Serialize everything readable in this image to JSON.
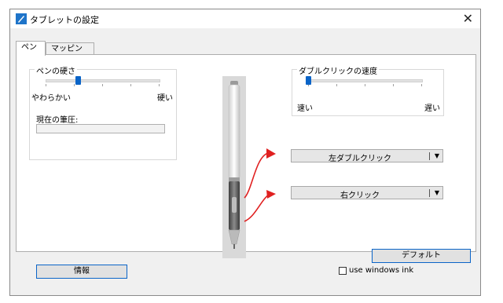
{
  "window": {
    "title": "タブレットの設定",
    "close_glyph": "✕"
  },
  "tabs": [
    {
      "label": "ペン"
    },
    {
      "label": "マッピング"
    }
  ],
  "pen_hardness": {
    "group_label": "ペンの硬さ",
    "min_label": "やわらかい",
    "max_label": "硬い",
    "slider_level": 0.28
  },
  "pressure": {
    "label": "現在の筆圧:"
  },
  "double_click_speed": {
    "group_label": "ダブルクリックの速度",
    "min_label": "速い",
    "max_label": "遅い",
    "slider_level": 0.0
  },
  "pen_buttons": {
    "upper": {
      "value": "左ダブルクリック"
    },
    "lower": {
      "value": "右クリック"
    },
    "arrow_color": "#e02020"
  },
  "buttons": {
    "default_label": "デフォルト",
    "info_label": "情報"
  },
  "windows_ink": {
    "label": "use windows ink",
    "checked": false
  },
  "colors": {
    "accent": "#0a64c8",
    "background": "#f0f0f0"
  }
}
